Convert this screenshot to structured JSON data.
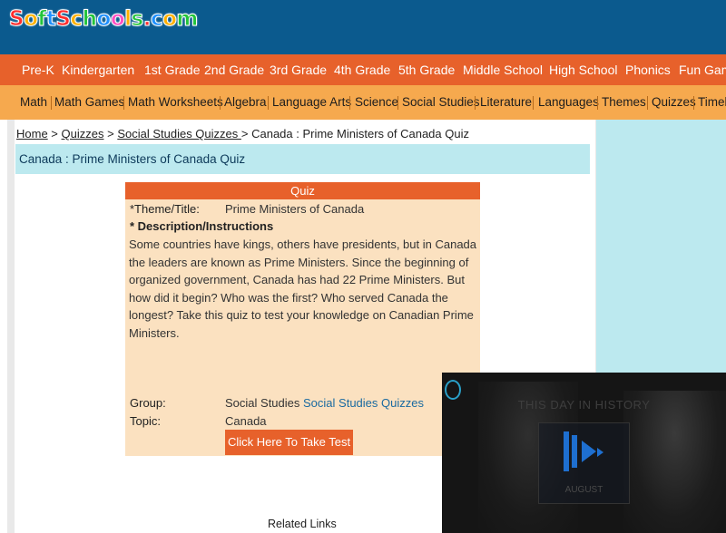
{
  "logo": {
    "text": "SoftSchools.com",
    "letters": [
      "S",
      "o",
      "f",
      "t",
      "S",
      "c",
      "h",
      "o",
      "o",
      "l",
      "s",
      ".",
      "c",
      "o",
      "m"
    ],
    "colors": [
      "#ff2d2d",
      "#ffb000",
      "#22c43a",
      "#1e90ff",
      "#ff2d2d",
      "#ffb000",
      "#22c43a",
      "#1e90ff",
      "#ff4fc3",
      "#ffb000",
      "#22c43a",
      "#ff2d2d",
      "#1e90ff",
      "#ffb000",
      "#22c43a"
    ]
  },
  "nav_primary": [
    "Pre-K",
    "Kindergarten",
    "1st Grade",
    "2nd Grade",
    "3rd Grade",
    "4th Grade",
    "5th Grade",
    "Middle School",
    "High School",
    "Phonics",
    "Fun Games"
  ],
  "nav_secondary": [
    "Math",
    "Math Games",
    "Math Worksheets",
    "Algebra",
    "Language Arts",
    "Science",
    "Social Studies",
    "Literature",
    "Languages",
    "Themes",
    "Quizzes",
    "Timelines"
  ],
  "breadcrumb": {
    "home": "Home",
    "sep": " > ",
    "quizzes": "Quizzes",
    "ss_quizzes": "Social Studies Quizzes ",
    "current": " Canada : Prime Ministers of Canada Quiz"
  },
  "page_title": "Canada : Prime Ministers of Canada Quiz",
  "quiz": {
    "header": "Quiz",
    "theme_label": "*Theme/Title:",
    "theme_value": "Prime Ministers of Canada",
    "desc_label": "* Description/Instructions",
    "description": "Some countries have kings, others have presidents, but in Canada the leaders are known as Prime Ministers. Since the beginning of organized government, Canada has had 22 Prime Ministers. But how did it begin? Who was the first? Who served Canada the longest? Take this quiz to test your knowledge on Canadian Prime Ministers.",
    "group_label": "Group:",
    "group_value": "Social Studies",
    "group_link": "Social Studies Quizzes",
    "topic_label": "Topic:",
    "topic_value": "Canada",
    "take_button": "Click Here To Take Test"
  },
  "related_links": "Related Links",
  "video": {
    "title": "THIS DAY IN HISTORY",
    "month": "AUGUST",
    "brand_icon": "history-logo-icon"
  },
  "colors": {
    "header_blue": "#0b5a8e",
    "nav_orange": "#e7612b",
    "nav_light_orange": "#f6a94e",
    "light_cyan": "#bce9ef",
    "quiz_bg": "#fbe1c0",
    "link_blue": "#1a6aa0"
  }
}
